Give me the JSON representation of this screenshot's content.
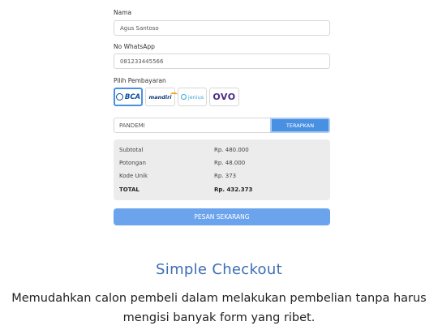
{
  "form": {
    "name_label": "Nama",
    "name_value": "Agus Santoso",
    "whatsapp_label": "No WhatsApp",
    "whatsapp_value": "081233445566",
    "payment_label": "Pilih Pembayaran",
    "payment_methods": [
      {
        "name": "BCA",
        "icon": "bca-logo",
        "selected": true
      },
      {
        "name": "mandiri",
        "icon": "mandiri-logo",
        "selected": false
      },
      {
        "name": "jenius",
        "icon": "jenius-logo",
        "selected": false
      },
      {
        "name": "OVO",
        "icon": "ovo-logo",
        "selected": false
      }
    ],
    "promo_value": "PANDEMI",
    "apply_label": "TERAPKAN",
    "order_label": "PESAN SEKARANG"
  },
  "summary": {
    "rows": [
      {
        "label": "Subtotal",
        "value": "Rp. 480.000"
      },
      {
        "label": "Potongan",
        "value": "Rp. 48.000"
      },
      {
        "label": "Kode Unik",
        "value": "Rp. 373"
      },
      {
        "label": "TOTAL",
        "value": "Rp. 432.373"
      }
    ]
  },
  "feature": {
    "title": "Simple Checkout",
    "description_line1": "Memudahkan calon pembeli dalam melakukan pembelian tanpa harus",
    "description_line2": "mengisi banyak form yang ribet."
  },
  "colors": {
    "accent": "#4a90e2",
    "order_button": "#6ba3ec",
    "title": "#3d6db5",
    "summary_bg": "#ececec"
  }
}
